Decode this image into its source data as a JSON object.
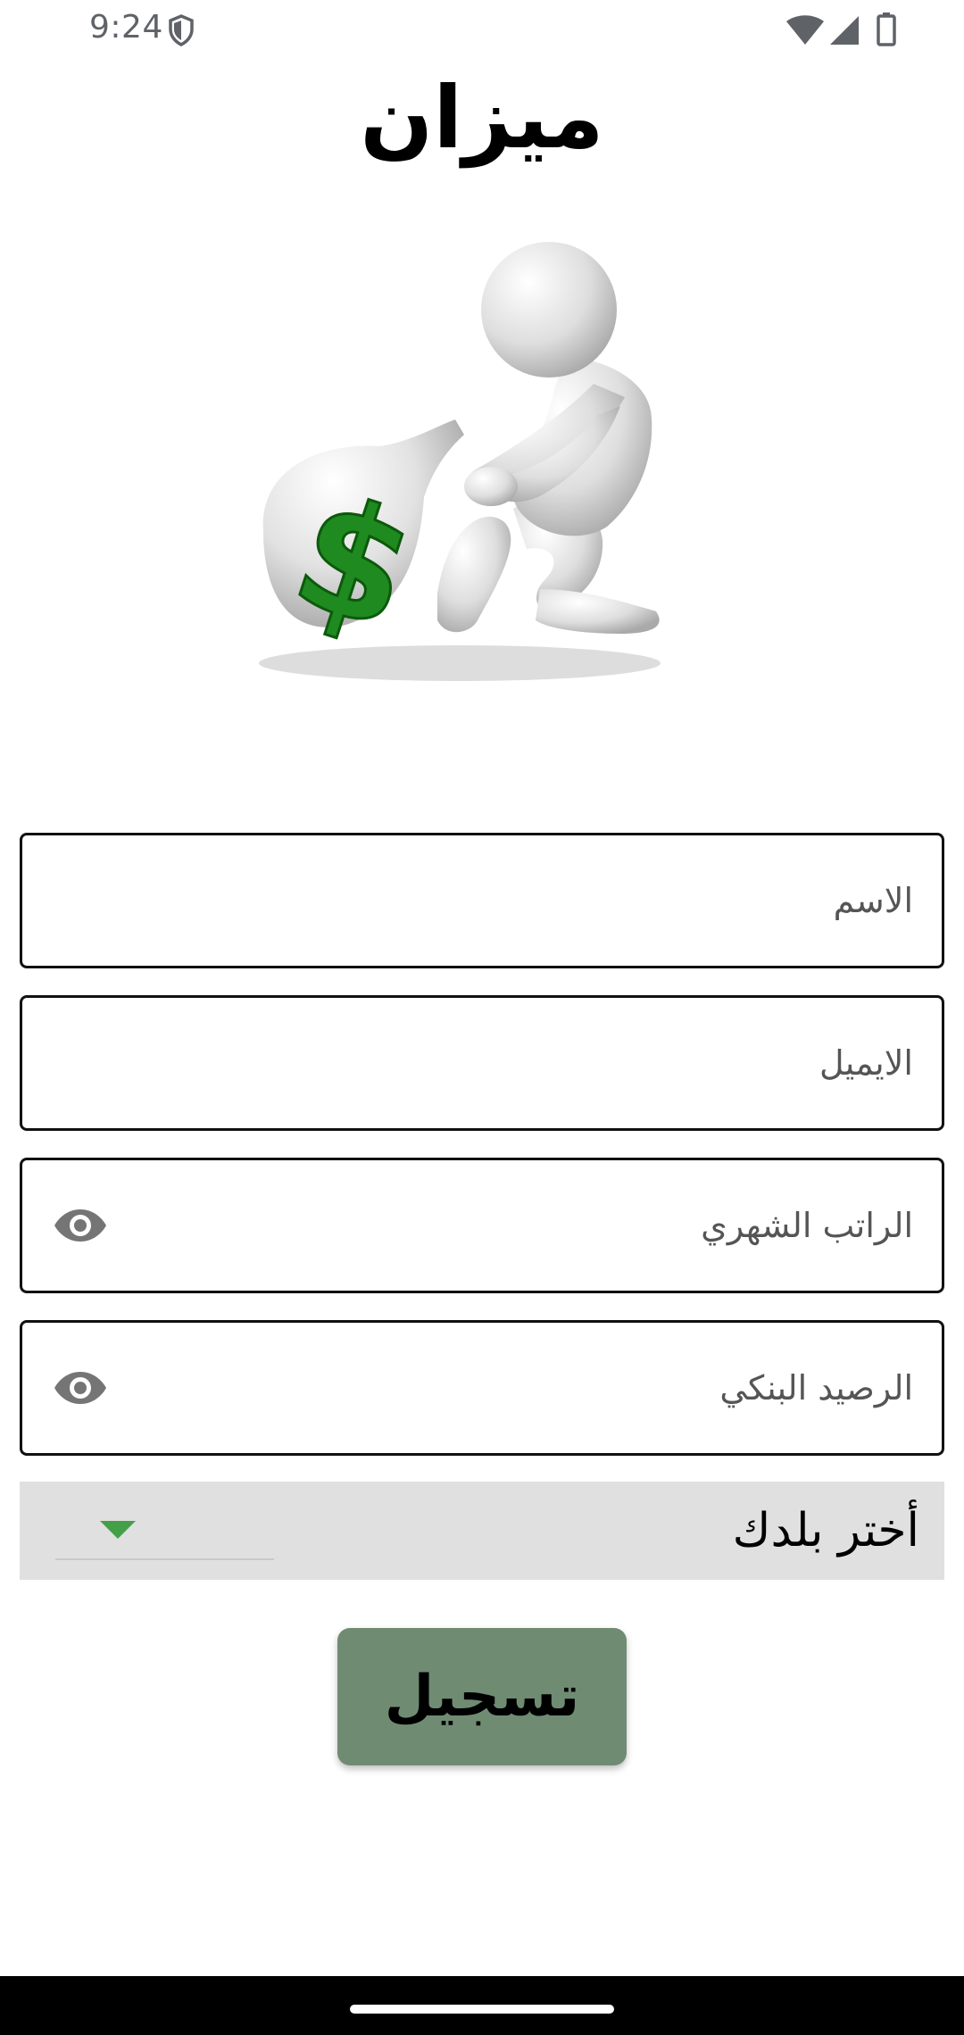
{
  "status_bar": {
    "time": "9:24",
    "icons": [
      "shield-icon",
      "wifi-icon",
      "signal-icon",
      "battery-icon"
    ]
  },
  "app": {
    "title": "ميزان"
  },
  "illustration": {
    "icon": "figure-pulling-money-bag",
    "symbol": "$",
    "accent_color": "#1f8a1f"
  },
  "form": {
    "name_placeholder": "الاسم",
    "email_placeholder": "الايميل",
    "salary_placeholder": "الراتب الشهري",
    "balance_placeholder": "الرصيد البنكي",
    "country_label": "أختر بلدك",
    "register_label": "تسجيل"
  },
  "colors": {
    "button": "#6f8c73",
    "select_background": "#e0e0e0",
    "dropdown_arrow": "#43a047"
  }
}
